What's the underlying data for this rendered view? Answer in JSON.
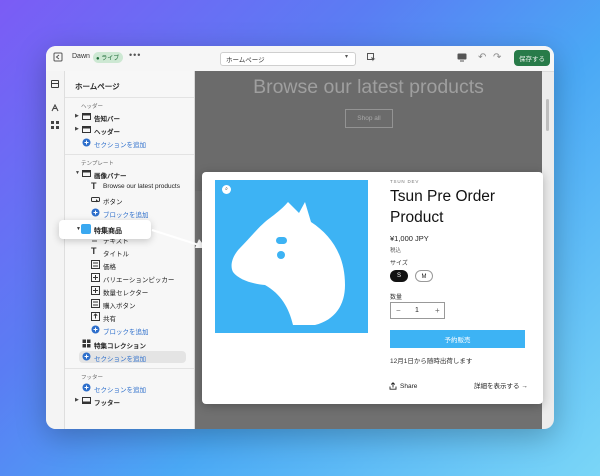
{
  "topbar": {
    "theme_name": "Dawn",
    "live_badge": "● ライブ",
    "more_label": "•••",
    "page_select": "ホームページ",
    "undo_label": "↶",
    "redo_label": "↷",
    "save_label": "保存する"
  },
  "sidebar": {
    "title": "ホームページ",
    "header_group": "ヘッダー",
    "header_items": [
      "告知バー",
      "ヘッダー"
    ],
    "header_add": "セクションを追加",
    "template_group": "テンプレート",
    "image_banner": {
      "label": "画像バナー",
      "children": [
        "Browse our latest products",
        "ボタン"
      ],
      "add_block": "ブロックを追加"
    },
    "featured_product": {
      "label": "特集商品",
      "children": [
        "テキスト",
        "タイトル",
        "価格",
        "バリエーションピッカー",
        "数量セレクター",
        "購入ボタン",
        "共有"
      ],
      "add_block": "ブロックを追加"
    },
    "featured_collection": "特集コレクション",
    "template_add": "セクションを追加",
    "footer_group": "フッター",
    "footer_add": "セクションを追加",
    "footer_item": "フッター"
  },
  "preview": {
    "banner_title": "Browse our latest products",
    "shop_all": "Shop all"
  },
  "product": {
    "vendor": "TSUN DEV",
    "title": "Tsun Pre Order Product",
    "price": "¥1,000 JPY",
    "tax_note": "税込",
    "size_label": "サイズ",
    "sizes": [
      "S",
      "M"
    ],
    "selected_size": "S",
    "qty_label": "数量",
    "qty_minus": "−",
    "qty_value": "1",
    "qty_plus": "+",
    "preorder_button": "予約販売",
    "ship_note": "12月1日から随時出荷します",
    "share": "Share",
    "details": "詳細を表示する →"
  },
  "colors": {
    "accent": "#3db3f4",
    "save": "#287b49",
    "link": "#2c6ecb"
  }
}
